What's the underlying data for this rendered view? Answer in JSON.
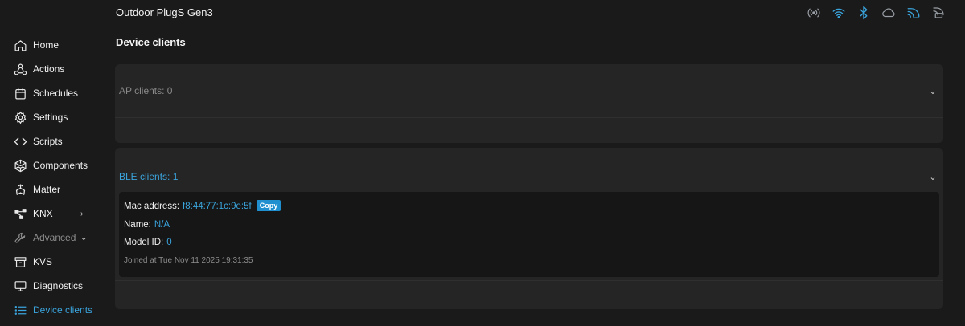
{
  "header": {
    "title": "Outdoor PlugS Gen3",
    "status_icons": [
      {
        "name": "broadcast-icon",
        "color": "#9aa0a6"
      },
      {
        "name": "wifi-icon",
        "color": "#3aa4dc"
      },
      {
        "name": "bluetooth-icon",
        "color": "#3aa4dc"
      },
      {
        "name": "cloud-icon",
        "color": "#9aa0a6"
      },
      {
        "name": "mqtt-icon",
        "color": "#3aa4dc"
      },
      {
        "name": "outbound-ws-icon",
        "color": "#9aa0a6"
      }
    ]
  },
  "sidebar": {
    "items": [
      {
        "label": "Home",
        "icon": "home-icon"
      },
      {
        "label": "Actions",
        "icon": "actions-icon"
      },
      {
        "label": "Schedules",
        "icon": "calendar-icon"
      },
      {
        "label": "Settings",
        "icon": "gear-icon"
      },
      {
        "label": "Scripts",
        "icon": "code-icon"
      },
      {
        "label": "Components",
        "icon": "components-icon"
      },
      {
        "label": "Matter",
        "icon": "matter-icon"
      },
      {
        "label": "KNX",
        "icon": "knx-icon",
        "chevron": "right"
      },
      {
        "label": "Advanced",
        "icon": "wrench-icon",
        "chevron": "down"
      },
      {
        "label": "KVS",
        "icon": "archive-icon"
      },
      {
        "label": "Diagnostics",
        "icon": "monitor-icon"
      },
      {
        "label": "Device clients",
        "icon": "list-icon",
        "active": true
      }
    ]
  },
  "main": {
    "title": "Device clients",
    "ap_panel": {
      "label": "AP clients: 0"
    },
    "ble_panel": {
      "label": "BLE clients: 1",
      "client": {
        "mac_label": "Mac address:",
        "mac_value": "f8:44:77:1c:9e:5f",
        "copy_label": "Copy",
        "name_label": "Name:",
        "name_value": "N/A",
        "model_label": "Model ID:",
        "model_value": "0",
        "joined": "Joined at Tue Nov 11 2025 19:31:35"
      }
    }
  },
  "colors": {
    "accent": "#3aa4dc",
    "background": "#1a1a1b",
    "panel": "#252526"
  }
}
